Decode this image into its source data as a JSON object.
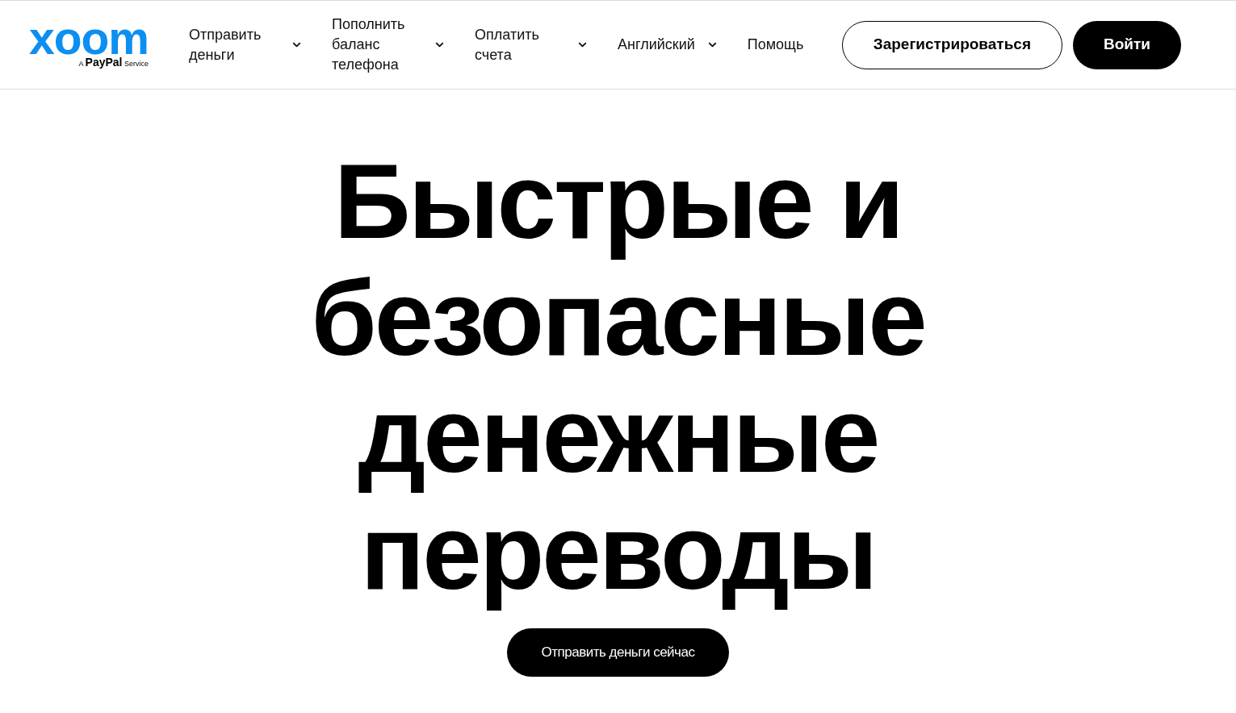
{
  "header": {
    "logo": {
      "wordmark": "xoom",
      "tagline": "A **PayPal** Service"
    },
    "nav": [
      {
        "label": "Отправить деньги",
        "kind": "dropdown"
      },
      {
        "label": "Пополнить баланс телефона",
        "kind": "dropdown"
      },
      {
        "label": "Оплатить счета",
        "kind": "dropdown"
      },
      {
        "label": "Английский",
        "kind": "dropdown"
      },
      {
        "label": "Помощь",
        "kind": "link"
      }
    ],
    "buttons": [
      {
        "label": "Зарегистрироваться",
        "kind": "outline"
      },
      {
        "label": "Войти",
        "kind": "filled"
      }
    ]
  },
  "hero": {
    "heading": "Быстрые и безопасные денежные переводы",
    "cta": "Отправить деньги сейчас"
  }
}
